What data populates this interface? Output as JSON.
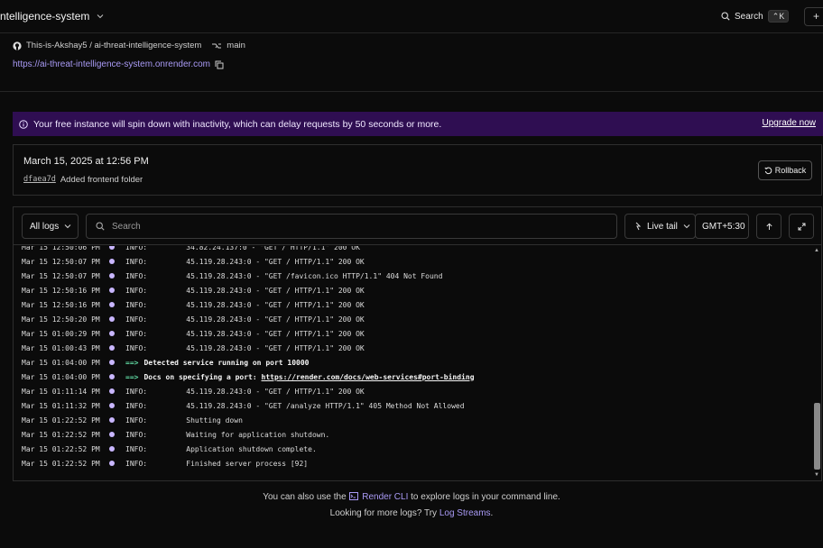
{
  "header": {
    "service_name": "ntelligence-system",
    "search_label": "Search",
    "search_shortcut": "⌃K",
    "new_button": "+"
  },
  "repo": {
    "path": "This-is-Akshay5 / ai-threat-intelligence-system",
    "branch": "main",
    "url": "https://ai-threat-intelligence-system.onrender.com"
  },
  "banner": {
    "message": "Your free instance will spin down with inactivity, which can delay requests by 50 seconds or more.",
    "upgrade_label": "Upgrade now"
  },
  "deploy": {
    "date": "March 15, 2025 at 12:56 PM",
    "commit_hash": "dfaea7d",
    "commit_message": "Added frontend folder",
    "rollback_label": "Rollback"
  },
  "logs_toolbar": {
    "filter_label": "All logs",
    "search_placeholder": "Search",
    "live_tail_label": "Live tail",
    "timezone": "GMT+5:30"
  },
  "logs": [
    {
      "ts": "Mar 15 12:50:06 PM",
      "level": "INFO:",
      "msg": "    34.82.24.137:0 - \"GET / HTTP/1.1\" 200 OK"
    },
    {
      "ts": "Mar 15 12:50:07 PM",
      "level": "INFO:",
      "msg": "    45.119.28.243:0 - \"GET / HTTP/1.1\" 200 OK"
    },
    {
      "ts": "Mar 15 12:50:07 PM",
      "level": "INFO:",
      "msg": "    45.119.28.243:0 - \"GET /favicon.ico HTTP/1.1\" 404 Not Found"
    },
    {
      "ts": "Mar 15 12:50:16 PM",
      "level": "INFO:",
      "msg": "    45.119.28.243:0 - \"GET / HTTP/1.1\" 200 OK"
    },
    {
      "ts": "Mar 15 12:50:16 PM",
      "level": "INFO:",
      "msg": "    45.119.28.243:0 - \"GET / HTTP/1.1\" 200 OK"
    },
    {
      "ts": "Mar 15 12:50:20 PM",
      "level": "INFO:",
      "msg": "    45.119.28.243:0 - \"GET / HTTP/1.1\" 200 OK"
    },
    {
      "ts": "Mar 15 01:00:29 PM",
      "level": "INFO:",
      "msg": "    45.119.28.243:0 - \"GET / HTTP/1.1\" 200 OK"
    },
    {
      "ts": "Mar 15 01:00:43 PM",
      "level": "INFO:",
      "msg": "    45.119.28.243:0 - \"GET / HTTP/1.1\" 200 OK"
    },
    {
      "ts": "Mar 15 01:04:00 PM",
      "level": "==>",
      "msg": "Detected service running on port 10000",
      "kind": "detect"
    },
    {
      "ts": "Mar 15 01:04:00 PM",
      "level": "==>",
      "msg": "Docs on specifying a port: ",
      "link": "https://render.com/docs/web-services#port-binding",
      "kind": "docs"
    },
    {
      "ts": "Mar 15 01:11:14 PM",
      "level": "INFO:",
      "msg": "    45.119.28.243:0 - \"GET / HTTP/1.1\" 200 OK"
    },
    {
      "ts": "Mar 15 01:11:32 PM",
      "level": "INFO:",
      "msg": "    45.119.28.243:0 - \"GET /analyze HTTP/1.1\" 405 Method Not Allowed"
    },
    {
      "ts": "Mar 15 01:22:52 PM",
      "level": "INFO:",
      "msg": "    Shutting down"
    },
    {
      "ts": "Mar 15 01:22:52 PM",
      "level": "INFO:",
      "msg": "    Waiting for application shutdown."
    },
    {
      "ts": "Mar 15 01:22:52 PM",
      "level": "INFO:",
      "msg": "    Application shutdown complete."
    },
    {
      "ts": "Mar 15 01:22:52 PM",
      "level": "INFO:",
      "msg": "    Finished server process [92]"
    }
  ],
  "footer": {
    "line1_prefix": "You can also use the",
    "cli_label": "Render CLI",
    "line1_suffix": "to explore logs in your command line.",
    "line2_prefix": "Looking for more logs? Try",
    "streams_label": "Log Streams",
    "line2_suffix": "."
  },
  "colors": {
    "banner_bg": "#2f0e52",
    "accent": "#a99af5",
    "arrow_green": "#5fd6a0",
    "dot": "#c9b6ff"
  }
}
